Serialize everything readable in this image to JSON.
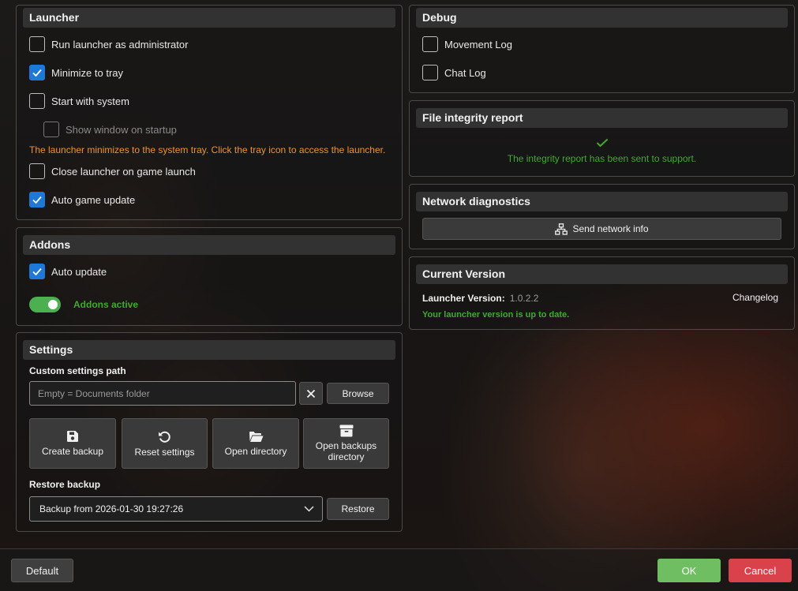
{
  "launcher": {
    "title": "Launcher",
    "items": [
      {
        "label": "Run launcher as administrator",
        "checked": false
      },
      {
        "label": "Minimize to tray",
        "checked": true
      },
      {
        "label": "Start with system",
        "checked": false
      },
      {
        "label": "Show window on startup",
        "checked": false
      },
      {
        "label": "Close launcher on game launch",
        "checked": false
      },
      {
        "label": "Auto game update",
        "checked": true
      }
    ],
    "tray_note": "The launcher minimizes to the system tray. Click the tray icon to access the launcher."
  },
  "addons": {
    "title": "Addons",
    "auto_update_label": "Auto update",
    "auto_update_checked": true,
    "toggle_label": "Addons active",
    "toggle_on": true
  },
  "settings": {
    "title": "Settings",
    "custom_path_label": "Custom settings path",
    "path_placeholder": "Empty = Documents folder",
    "clear_symbol": "✕",
    "browse_label": "Browse",
    "tiles": [
      {
        "label": "Create backup",
        "icon": "floppy-disk-icon"
      },
      {
        "label": "Reset settings",
        "icon": "reset-arrow-icon"
      },
      {
        "label": "Open directory",
        "icon": "folder-open-icon"
      },
      {
        "label": "Open backups directory",
        "icon": "archive-box-icon"
      }
    ],
    "restore_label": "Restore backup",
    "backup_selected": "Backup from 2026-01-30 19:27:26",
    "restore_button": "Restore"
  },
  "debug": {
    "title": "Debug",
    "items": [
      {
        "label": "Movement Log",
        "checked": false
      },
      {
        "label": "Chat Log",
        "checked": false
      }
    ]
  },
  "integrity": {
    "title": "File integrity report",
    "message": "The integrity report has been sent to support."
  },
  "network": {
    "title": "Network diagnostics",
    "button": "Send network info"
  },
  "version": {
    "title": "Current Version",
    "label": "Launcher Version:",
    "value": "1.0.2.2",
    "changelog": "Changelog",
    "status": "Your launcher version is up to date."
  },
  "footer": {
    "default_label": "Default",
    "ok_label": "OK",
    "cancel_label": "Cancel"
  },
  "colors": {
    "accent": "#1e78d7",
    "ok": "#6fbf62",
    "cancel": "#d9414b",
    "success_text": "#3faa2e",
    "warning_text": "#f0922a"
  }
}
